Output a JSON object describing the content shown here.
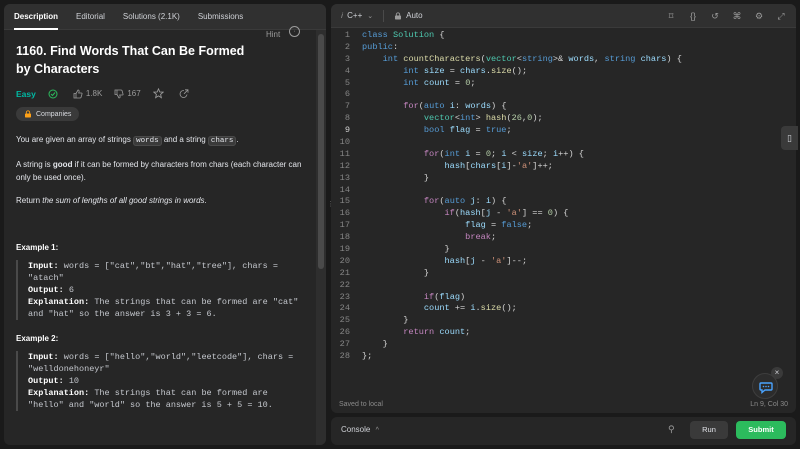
{
  "left_tabs": [
    "Description",
    "Editorial",
    "Solutions (2.1K)",
    "Submissions"
  ],
  "problem": {
    "title": "1160. Find Words That Can Be Formed by Characters",
    "hint_label": "Hint",
    "difficulty": "Easy",
    "likes": "1.8K",
    "dislikes": "167",
    "companies_label": "Companies",
    "desc1_pre": "You are given an array of strings ",
    "desc1_code1": "words",
    "desc1_mid": " and a string ",
    "desc1_code2": "chars",
    "desc1_post": ".",
    "desc2_pre": "A string is ",
    "desc2_bold": "good",
    "desc2_post": " if it can be formed by characters from chars (each character can only be used once).",
    "desc3_pre": "Return ",
    "desc3_em": "the sum of lengths of all good strings in words",
    "desc3_post": "."
  },
  "examples": [
    {
      "title": "Example 1:",
      "input_label": "Input:",
      "input": "words = [\"cat\",\"bt\",\"hat\",\"tree\"], chars = \"atach\"",
      "output_label": "Output:",
      "output": "6",
      "explanation_label": "Explanation:",
      "explanation": "The strings that can be formed are \"cat\" and \"hat\" so the answer is 3 + 3 = 6."
    },
    {
      "title": "Example 2:",
      "input_label": "Input:",
      "input": "words = [\"hello\",\"world\",\"leetcode\"], chars = \"welldonehoneyr\"",
      "output_label": "Output:",
      "output": "10",
      "explanation_label": "Explanation:",
      "explanation": "The strings that can be formed are \"hello\" and \"world\" so the answer is 5 + 5 = 10."
    }
  ],
  "editor": {
    "language": "C++",
    "autosave": "Auto",
    "saved_status": "Saved to local",
    "cursor": "Ln 9, Col 30",
    "current_line": 9
  },
  "code_lines": [
    [
      [
        "k",
        "class "
      ],
      [
        "t",
        "Solution"
      ],
      [
        "p",
        " {"
      ]
    ],
    [
      [
        "k",
        "public"
      ],
      [
        "p",
        ":"
      ]
    ],
    [
      [
        "p",
        "    "
      ],
      [
        "k",
        "int "
      ],
      [
        "f",
        "countCharacters"
      ],
      [
        "p",
        "("
      ],
      [
        "t",
        "vector"
      ],
      [
        "p",
        "<"
      ],
      [
        "k",
        "string"
      ],
      [
        "p",
        ">& "
      ],
      [
        "v",
        "words"
      ],
      [
        "p",
        ", "
      ],
      [
        "k",
        "string "
      ],
      [
        "v",
        "chars"
      ],
      [
        "p",
        ") {"
      ]
    ],
    [
      [
        "p",
        "        "
      ],
      [
        "k",
        "int "
      ],
      [
        "v",
        "size"
      ],
      [
        "p",
        " = "
      ],
      [
        "v",
        "chars"
      ],
      [
        "p",
        "."
      ],
      [
        "f",
        "size"
      ],
      [
        "p",
        "();"
      ]
    ],
    [
      [
        "p",
        "        "
      ],
      [
        "k",
        "int "
      ],
      [
        "v",
        "count"
      ],
      [
        "p",
        " = "
      ],
      [
        "n",
        "0"
      ],
      [
        "p",
        ";"
      ]
    ],
    [
      [
        "p",
        ""
      ]
    ],
    [
      [
        "p",
        "        "
      ],
      [
        "c",
        "for"
      ],
      [
        "p",
        "("
      ],
      [
        "k",
        "auto "
      ],
      [
        "v",
        "i"
      ],
      [
        "p",
        ": "
      ],
      [
        "v",
        "words"
      ],
      [
        "p",
        ") {"
      ]
    ],
    [
      [
        "p",
        "            "
      ],
      [
        "t",
        "vector"
      ],
      [
        "p",
        "<"
      ],
      [
        "k",
        "int"
      ],
      [
        "p",
        "> "
      ],
      [
        "f",
        "hash"
      ],
      [
        "p",
        "("
      ],
      [
        "n",
        "26"
      ],
      [
        "p",
        ","
      ],
      [
        "n",
        "0"
      ],
      [
        "p",
        ");"
      ]
    ],
    [
      [
        "p",
        "            "
      ],
      [
        "k",
        "bool "
      ],
      [
        "v",
        "flag"
      ],
      [
        "p",
        " = "
      ],
      [
        "k",
        "true"
      ],
      [
        "p",
        ";"
      ]
    ],
    [
      [
        "p",
        ""
      ]
    ],
    [
      [
        "p",
        "            "
      ],
      [
        "c",
        "for"
      ],
      [
        "p",
        "("
      ],
      [
        "k",
        "int "
      ],
      [
        "v",
        "i"
      ],
      [
        "p",
        " = "
      ],
      [
        "n",
        "0"
      ],
      [
        "p",
        "; "
      ],
      [
        "v",
        "i"
      ],
      [
        "p",
        " < "
      ],
      [
        "v",
        "size"
      ],
      [
        "p",
        "; "
      ],
      [
        "v",
        "i"
      ],
      [
        "p",
        "++) {"
      ]
    ],
    [
      [
        "p",
        "                "
      ],
      [
        "v",
        "hash"
      ],
      [
        "p",
        "["
      ],
      [
        "v",
        "chars"
      ],
      [
        "p",
        "["
      ],
      [
        "v",
        "i"
      ],
      [
        "p",
        "]-"
      ],
      [
        "s",
        "'a'"
      ],
      [
        "p",
        "]++;"
      ]
    ],
    [
      [
        "p",
        "            }"
      ]
    ],
    [
      [
        "p",
        ""
      ]
    ],
    [
      [
        "p",
        "            "
      ],
      [
        "c",
        "for"
      ],
      [
        "p",
        "("
      ],
      [
        "k",
        "auto "
      ],
      [
        "v",
        "j"
      ],
      [
        "p",
        ": "
      ],
      [
        "v",
        "i"
      ],
      [
        "p",
        ") {"
      ]
    ],
    [
      [
        "p",
        "                "
      ],
      [
        "c",
        "if"
      ],
      [
        "p",
        "("
      ],
      [
        "v",
        "hash"
      ],
      [
        "p",
        "["
      ],
      [
        "v",
        "j"
      ],
      [
        "p",
        " - "
      ],
      [
        "s",
        "'a'"
      ],
      [
        "p",
        "] == "
      ],
      [
        "n",
        "0"
      ],
      [
        "p",
        ") {"
      ]
    ],
    [
      [
        "p",
        "                    "
      ],
      [
        "v",
        "flag"
      ],
      [
        "p",
        " = "
      ],
      [
        "k",
        "false"
      ],
      [
        "p",
        ";"
      ]
    ],
    [
      [
        "p",
        "                    "
      ],
      [
        "c",
        "break"
      ],
      [
        "p",
        ";"
      ]
    ],
    [
      [
        "p",
        "                }"
      ]
    ],
    [
      [
        "p",
        "                "
      ],
      [
        "v",
        "hash"
      ],
      [
        "p",
        "["
      ],
      [
        "v",
        "j"
      ],
      [
        "p",
        " - "
      ],
      [
        "s",
        "'a'"
      ],
      [
        "p",
        "]--;"
      ]
    ],
    [
      [
        "p",
        "            }"
      ]
    ],
    [
      [
        "p",
        ""
      ]
    ],
    [
      [
        "p",
        "            "
      ],
      [
        "c",
        "if"
      ],
      [
        "p",
        "("
      ],
      [
        "v",
        "flag"
      ],
      [
        "p",
        ")"
      ]
    ],
    [
      [
        "p",
        "            "
      ],
      [
        "v",
        "count"
      ],
      [
        "p",
        " += "
      ],
      [
        "v",
        "i"
      ],
      [
        "p",
        "."
      ],
      [
        "f",
        "size"
      ],
      [
        "p",
        "();"
      ]
    ],
    [
      [
        "p",
        "        }"
      ]
    ],
    [
      [
        "p",
        "        "
      ],
      [
        "c",
        "return "
      ],
      [
        "v",
        "count"
      ],
      [
        "p",
        ";"
      ]
    ],
    [
      [
        "p",
        "    }"
      ]
    ],
    [
      [
        "p",
        "};"
      ]
    ]
  ],
  "console": {
    "label": "Console",
    "run": "Run",
    "submit": "Submit"
  }
}
